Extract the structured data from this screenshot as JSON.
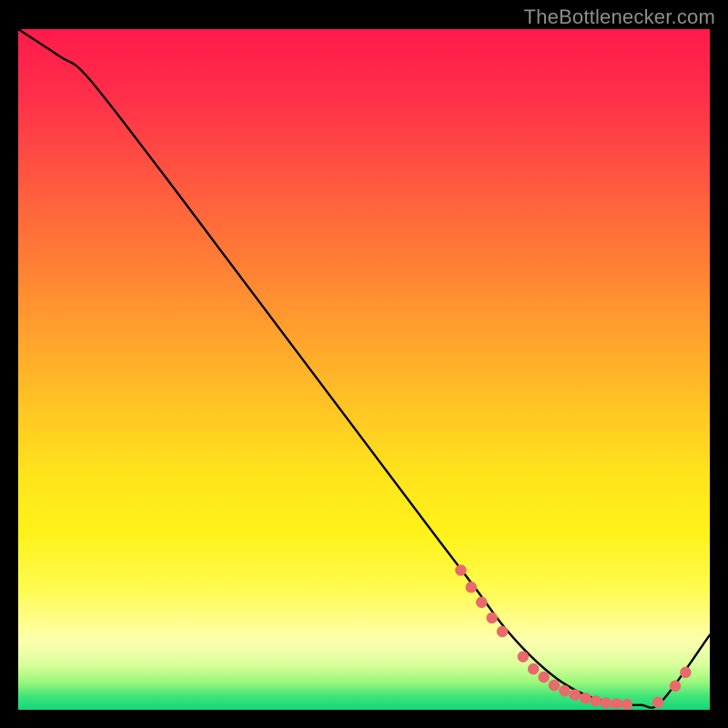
{
  "attribution": "TheBottlenecker.com",
  "chart_data": {
    "type": "line",
    "title": "",
    "xlabel": "",
    "ylabel": "",
    "xlim": [
      0,
      100
    ],
    "ylim": [
      0,
      100
    ],
    "x": [
      0,
      6,
      10,
      20,
      30,
      40,
      50,
      60,
      66,
      70,
      74,
      78,
      82,
      86,
      90,
      93,
      100
    ],
    "values": [
      100,
      96,
      93,
      80,
      66.5,
      53,
      39.5,
      26,
      18,
      12.5,
      8,
      4.5,
      2.2,
      1,
      0.7,
      1.2,
      11
    ],
    "series": [
      {
        "name": "curve",
        "x": [
          0,
          6,
          10,
          20,
          30,
          40,
          50,
          60,
          66,
          70,
          74,
          78,
          82,
          86,
          90,
          93,
          100
        ],
        "values": [
          100,
          96,
          93,
          80,
          66.5,
          53,
          39.5,
          26,
          18,
          12.5,
          8,
          4.5,
          2.2,
          1,
          0.7,
          1.2,
          11
        ]
      }
    ],
    "markers": [
      {
        "x": 64.0,
        "y": 20.5
      },
      {
        "x": 65.5,
        "y": 18.0
      },
      {
        "x": 67.0,
        "y": 15.8
      },
      {
        "x": 68.5,
        "y": 13.5
      },
      {
        "x": 70.0,
        "y": 11.5
      },
      {
        "x": 73.0,
        "y": 7.8
      },
      {
        "x": 74.5,
        "y": 6.0
      },
      {
        "x": 76.0,
        "y": 4.8
      },
      {
        "x": 77.5,
        "y": 3.6
      },
      {
        "x": 79.0,
        "y": 2.8
      },
      {
        "x": 80.5,
        "y": 2.2
      },
      {
        "x": 82.0,
        "y": 1.7
      },
      {
        "x": 83.5,
        "y": 1.3
      },
      {
        "x": 85.0,
        "y": 1.0
      },
      {
        "x": 86.5,
        "y": 0.9
      },
      {
        "x": 88.0,
        "y": 0.8
      },
      {
        "x": 92.5,
        "y": 1.1
      },
      {
        "x": 95.0,
        "y": 3.5
      },
      {
        "x": 96.5,
        "y": 5.5
      }
    ],
    "gradient_stops": [
      {
        "pos": 0.0,
        "color": "#ff1a4b"
      },
      {
        "pos": 0.1,
        "color": "#ff2f4a"
      },
      {
        "pos": 0.22,
        "color": "#ff5740"
      },
      {
        "pos": 0.33,
        "color": "#ff7a36"
      },
      {
        "pos": 0.44,
        "color": "#ff9f2e"
      },
      {
        "pos": 0.55,
        "color": "#ffc324"
      },
      {
        "pos": 0.65,
        "color": "#ffe31c"
      },
      {
        "pos": 0.74,
        "color": "#fff21a"
      },
      {
        "pos": 0.82,
        "color": "#fffb4d"
      },
      {
        "pos": 0.9,
        "color": "#fdffb0"
      },
      {
        "pos": 0.935,
        "color": "#d7ff9a"
      },
      {
        "pos": 0.96,
        "color": "#98f77a"
      },
      {
        "pos": 0.98,
        "color": "#3fe47a"
      },
      {
        "pos": 1.0,
        "color": "#13d67a"
      }
    ],
    "curve_color": "#000000",
    "marker_color": "#e86a6a"
  }
}
